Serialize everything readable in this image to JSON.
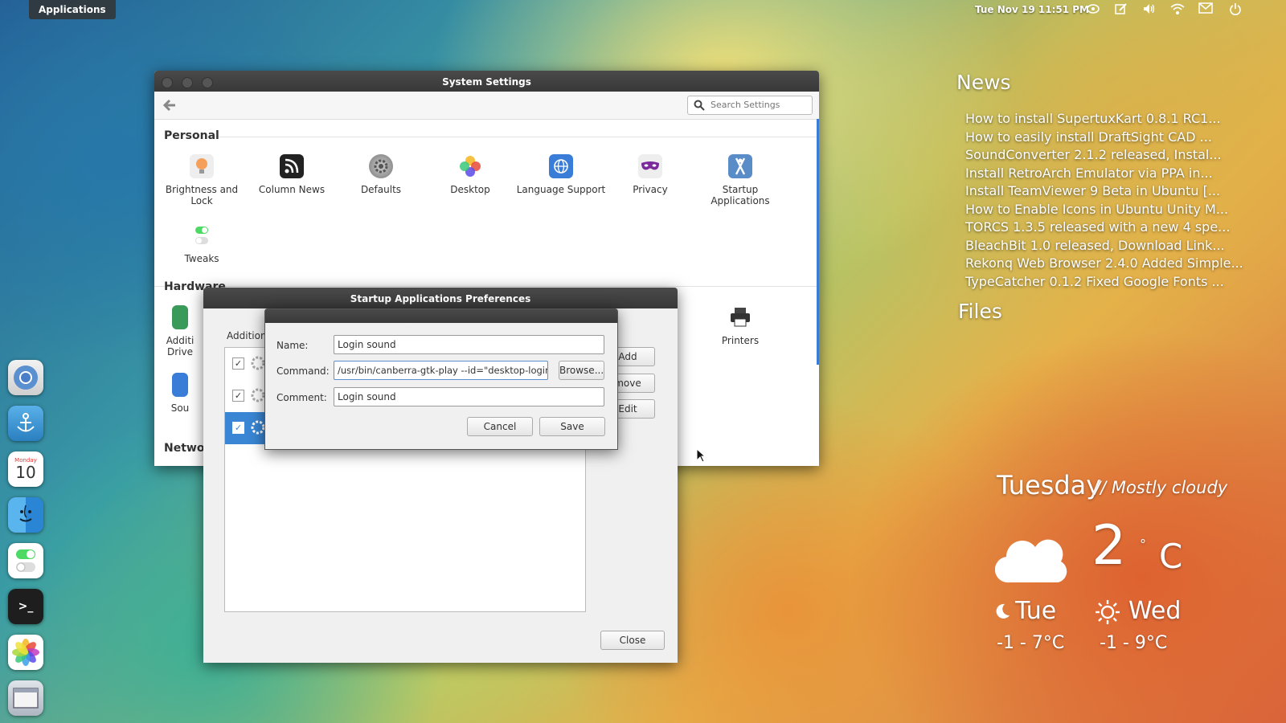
{
  "panel": {
    "apps_label": "Applications",
    "clock": "Tue Nov 19  11:51 PM"
  },
  "dock": {
    "calendar_day": "Monday",
    "calendar_date": "10",
    "terminal_prompt": ">_"
  },
  "settings": {
    "title": "System Settings",
    "search_placeholder": "Search Settings",
    "sections": {
      "personal": "Personal",
      "hardware": "Hardware",
      "network": "Network"
    },
    "personal_items": [
      {
        "label": "Brightness and Lock",
        "icon": "lightbulb-icon"
      },
      {
        "label": "Column News",
        "icon": "rss-icon"
      },
      {
        "label": "Defaults",
        "icon": "gear-icon"
      },
      {
        "label": "Desktop",
        "icon": "flower-icon"
      },
      {
        "label": "Language Support",
        "icon": "globe-icon"
      },
      {
        "label": "Privacy",
        "icon": "mask-icon"
      },
      {
        "label": "Startup Applications",
        "icon": "tools-icon"
      },
      {
        "label": "Tweaks",
        "icon": "toggle-icon"
      }
    ],
    "hardware_items": [
      {
        "label": "Additi Drive",
        "icon": "driver-icon"
      },
      {
        "label": "Sou",
        "icon": "sound-icon"
      },
      {
        "label": "Printers",
        "icon": "printer-icon"
      }
    ]
  },
  "startup": {
    "title": "Startup Applications Preferences",
    "additional_label": "Additiona",
    "buttons": {
      "add": "Add",
      "remove": "move",
      "edit": "Edit",
      "close": "Close"
    }
  },
  "edit_dialog": {
    "name_label": "Name:",
    "name_value": "Login sound",
    "command_label": "Command:",
    "command_value": "/usr/bin/canberra-gtk-play --id=\"desktop-login\"",
    "comment_label": "Comment:",
    "comment_value": "Login sound",
    "browse_label": "Browse...",
    "cancel_label": "Cancel",
    "save_label": "Save"
  },
  "news": {
    "title": "News",
    "items": [
      "How to install SupertuxKart 0.8.1 RC1...",
      "How to easily install DraftSight CAD ...",
      "SoundConverter 2.1.2 released, Instal...",
      "Install RetroArch Emulator via PPA in...",
      "Install TeamViewer 9 Beta in Ubuntu [...",
      "How to Enable Icons in Ubuntu Unity M...",
      "TORCS 1.3.5 released with a new 4 spe...",
      "BleachBit 1.0 released, Download Link...",
      "Rekonq Web Browser 2.4.0 Added Simple...",
      "TypeCatcher 0.1.2 Fixed Google Fonts ..."
    ],
    "files_title": "Files"
  },
  "weather": {
    "day": "Tuesday",
    "condition": "// Mostly cloudy",
    "temp": "2",
    "unit": "C",
    "forecast": [
      {
        "day": "Tue",
        "range": "-1 - 7°C",
        "icon": "moon-icon"
      },
      {
        "day": "Wed",
        "range": "-1 - 9°C",
        "icon": "sun-icon"
      }
    ]
  }
}
